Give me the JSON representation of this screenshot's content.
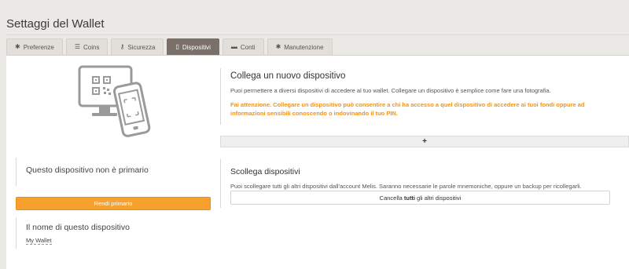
{
  "page": {
    "title": "Settaggi del Wallet"
  },
  "tabs": [
    {
      "label": "Preferenze",
      "icon": "gear-icon",
      "glyph": "✱",
      "active": false
    },
    {
      "label": "Coins",
      "icon": "database-icon",
      "glyph": "☰",
      "active": false
    },
    {
      "label": "Sicurezza",
      "icon": "key-icon",
      "glyph": "⚷",
      "active": false
    },
    {
      "label": "Dispositivi",
      "icon": "mobile-icon",
      "glyph": "▯",
      "active": true
    },
    {
      "label": "Conti",
      "icon": "folder-icon",
      "glyph": "▬",
      "active": false
    },
    {
      "label": "Manutenzione",
      "icon": "gear-icon",
      "glyph": "✱",
      "active": false
    }
  ],
  "connect": {
    "title": "Collega un nuovo dispositivo",
    "description": "Puoi permettere a diversi dispositivi di accedere al tuo wallet. Collegare un dispositivo è semplice come fare una fotografia.",
    "warning": "Fai attenzione. Collegare un dispositivo può consentire a chi ha accesso a quel dispositivo di accedere ai tuoi fondi oppure ad informazioni sensibili conoscendo o indovinando il tuo PIN.",
    "add_label": "+"
  },
  "primary": {
    "title": "Questo dispositivo non è primario",
    "button_label": "Rendi primario"
  },
  "device_name": {
    "title": "Il nome di questo dispositivo",
    "value": "My Wallet"
  },
  "disconnect": {
    "title": "Scollega dispositivi",
    "description": "Puoi scollegare tutti gli altri dispositivi dall'account Melis. Saranno necessarie le parole mnemoniche, oppure un backup per ricollegarli.",
    "button_pre": "Cancella",
    "button_bold": "tutti",
    "button_post": "gli altri dispositivi"
  },
  "colors": {
    "accent_orange": "#f7a12c",
    "warning_text": "#f0931b",
    "active_tab": "#7b6f69"
  }
}
